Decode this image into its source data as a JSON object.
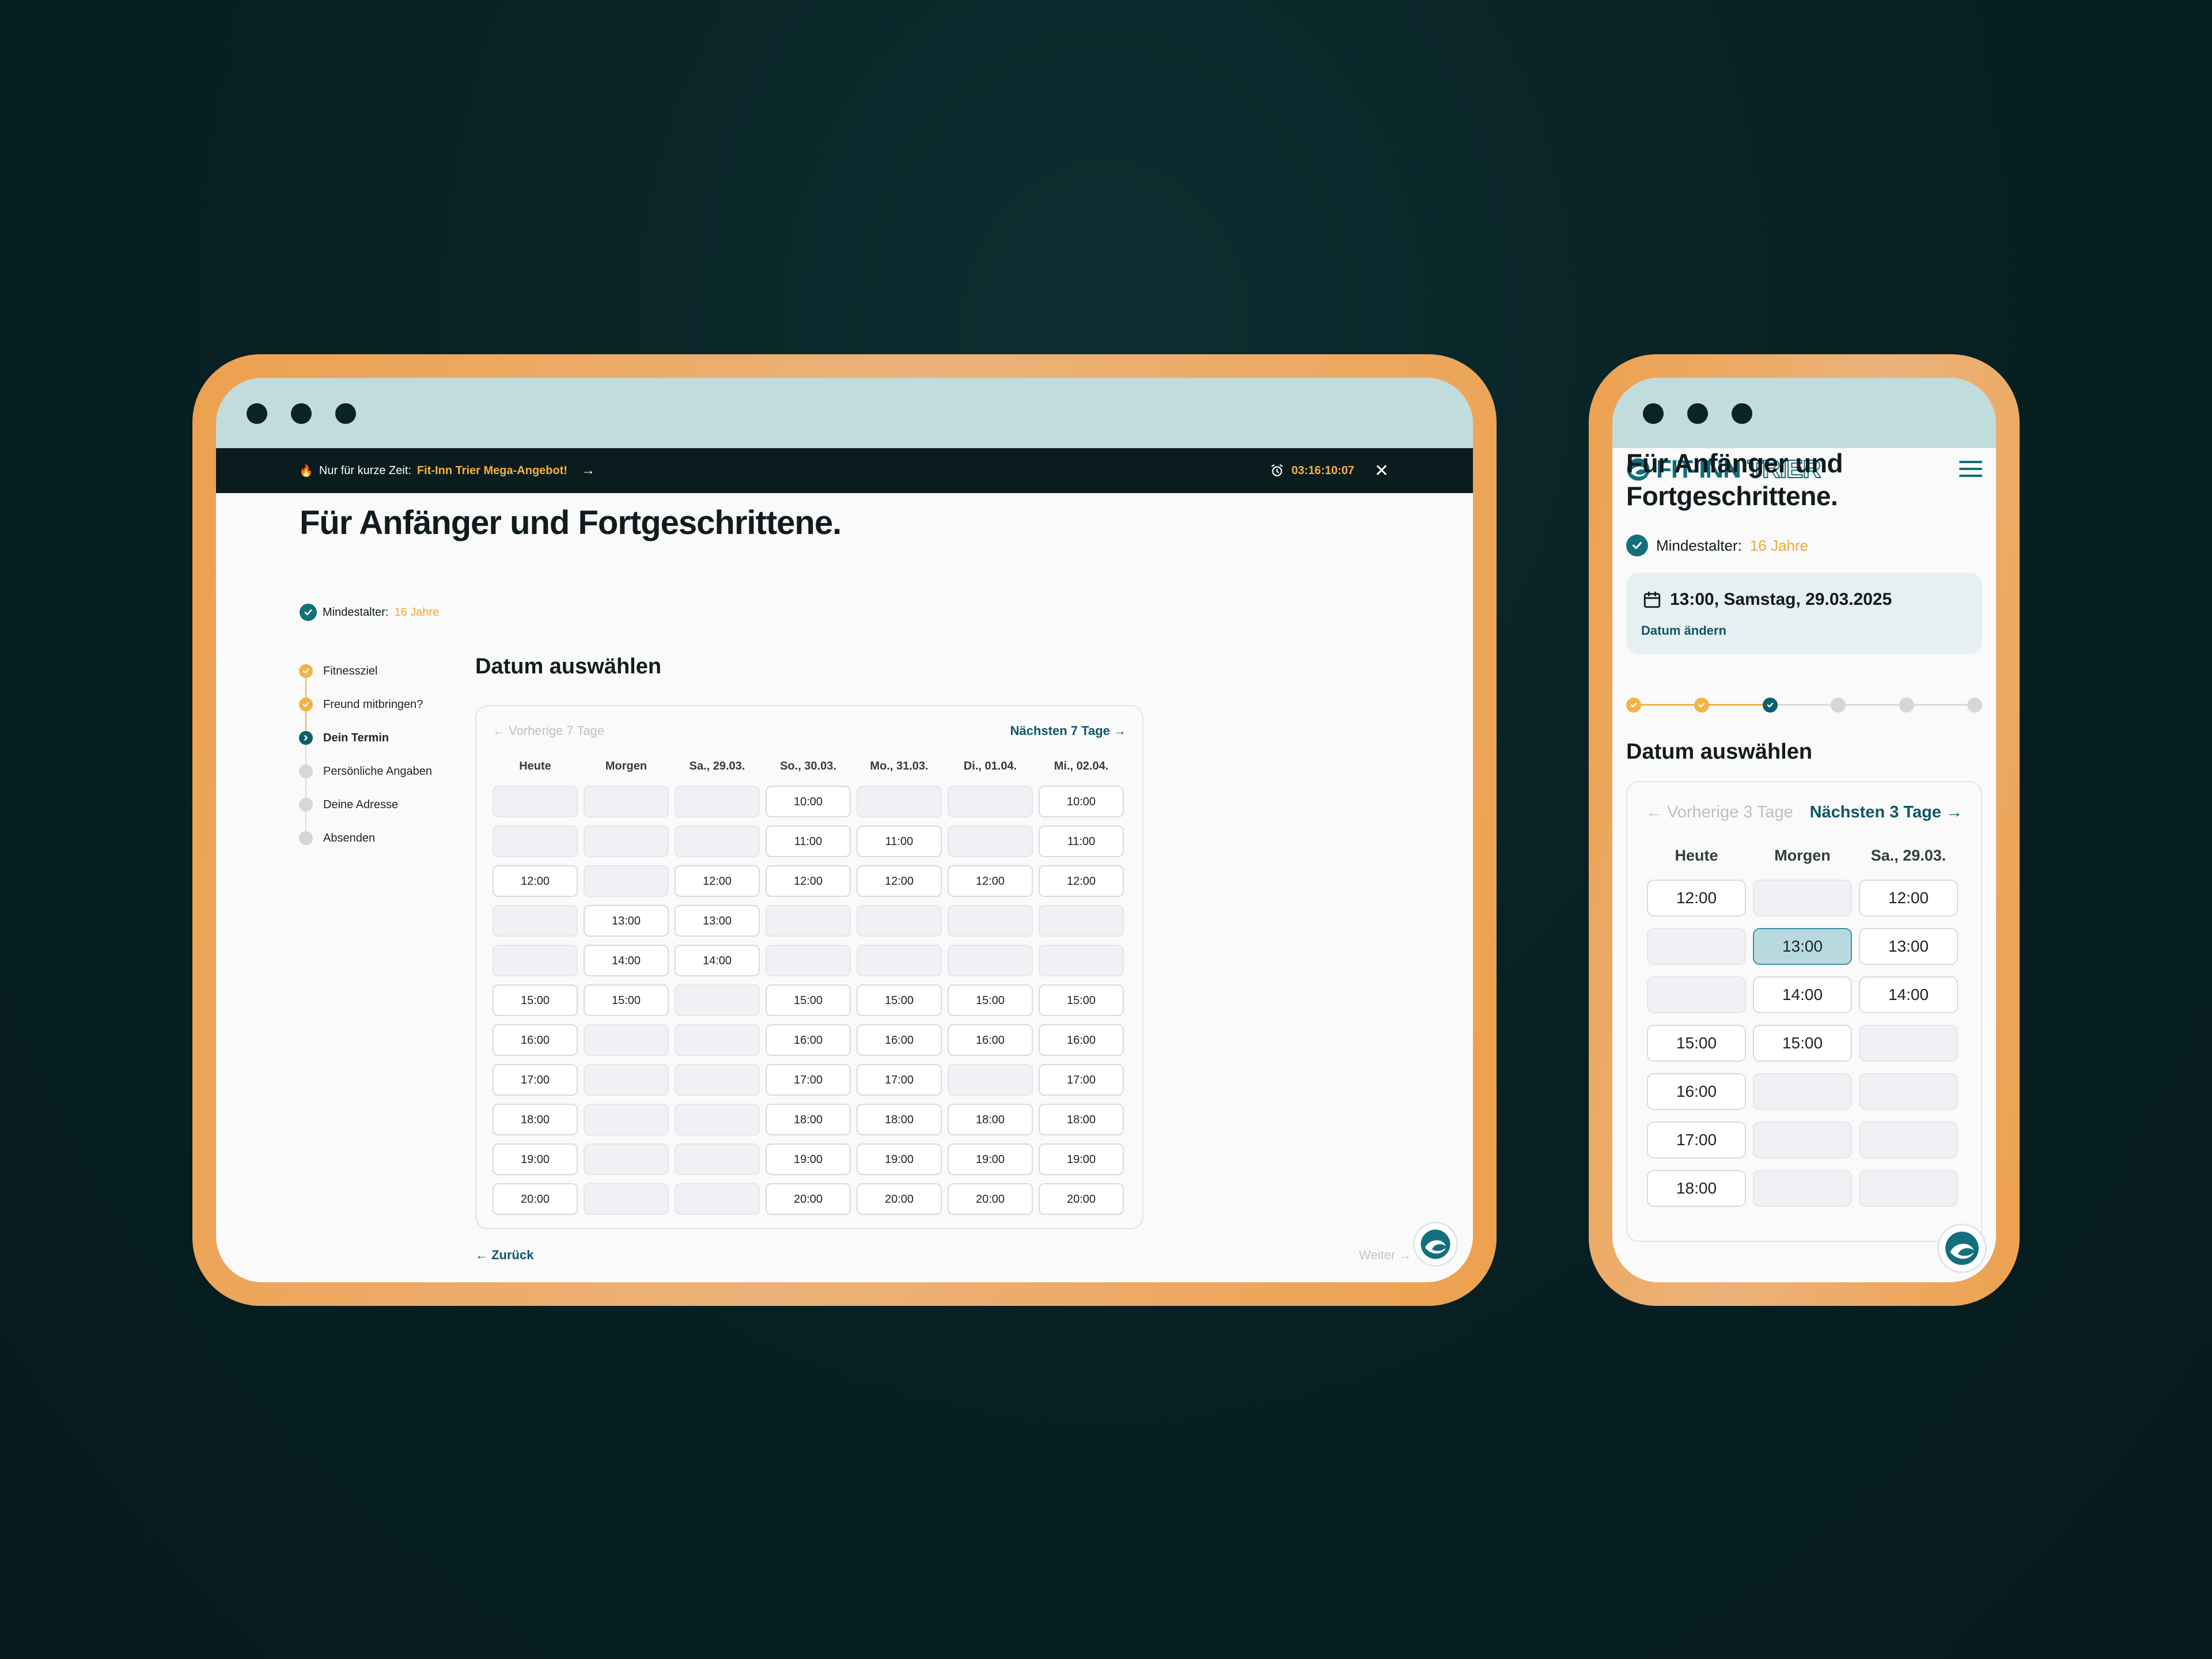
{
  "colors": {
    "background": "#082124",
    "frame_orange": "#eda14f",
    "titlebar": "#c1dcdd",
    "accent_teal": "#0f5766",
    "accent_orange": "#f0a93a",
    "selected_slot": "#b8dadf"
  },
  "desktop": {
    "promo": {
      "prefix": "Nur für kurze Zeit:",
      "highlight": "Fit-Inn Trier Mega-Angebot!",
      "arrow": "→",
      "timer": "03:16:10:07",
      "close": "✕"
    },
    "title": "Für Anfänger und Fortgeschrittene.",
    "age_label": "Mindestalter:",
    "age_value": "16 Jahre",
    "steps": [
      {
        "label": "Fitnessziel",
        "state": "done"
      },
      {
        "label": "Freund mitbringen?",
        "state": "done"
      },
      {
        "label": "Dein Termin",
        "state": "current"
      },
      {
        "label": "Persönliche Angaben",
        "state": "todo"
      },
      {
        "label": "Deine Adresse",
        "state": "todo"
      },
      {
        "label": "Absenden",
        "state": "todo"
      }
    ],
    "section_title": "Datum auswählen",
    "prev_label": "← Vorherige 7 Tage",
    "next_label": "Nächsten 7 Tage →",
    "days": [
      "Heute",
      "Morgen",
      "Sa., 29.03.",
      "So., 30.03.",
      "Mo., 31.03.",
      "Di., 01.04.",
      "Mi., 02.04."
    ],
    "rows": [
      [
        "",
        "",
        "",
        "10:00",
        "",
        "",
        "10:00"
      ],
      [
        "",
        "",
        "",
        "11:00",
        "11:00",
        "",
        "11:00"
      ],
      [
        "12:00",
        "",
        "12:00",
        "12:00",
        "12:00",
        "12:00",
        "12:00"
      ],
      [
        "",
        "13:00",
        "13:00",
        "",
        "",
        "",
        ""
      ],
      [
        "",
        "14:00",
        "14:00",
        "",
        "",
        "",
        ""
      ],
      [
        "15:00",
        "15:00",
        "",
        "15:00",
        "15:00",
        "15:00",
        "15:00"
      ],
      [
        "16:00",
        "",
        "",
        "16:00",
        "16:00",
        "16:00",
        "16:00"
      ],
      [
        "17:00",
        "",
        "",
        "17:00",
        "17:00",
        "",
        "17:00"
      ],
      [
        "18:00",
        "",
        "",
        "18:00",
        "18:00",
        "18:00",
        "18:00"
      ],
      [
        "19:00",
        "",
        "",
        "19:00",
        "19:00",
        "19:00",
        "19:00"
      ],
      [
        "20:00",
        "",
        "",
        "20:00",
        "20:00",
        "20:00",
        "20:00"
      ]
    ],
    "back_label": "← Zurück",
    "next_button": "Weiter →"
  },
  "mobile": {
    "logo_text": "FIT-INN",
    "logo_text2": "TRIER",
    "title": "Für Anfänger und Fortgeschrittene.",
    "age_label": "Mindestalter:",
    "age_value": "16 Jahre",
    "selected_date": "13:00, Samstag, 29.03.2025",
    "change_date": "Datum ändern",
    "progress_states": [
      "done",
      "done",
      "current",
      "todo",
      "todo",
      "todo"
    ],
    "section_title": "Datum auswählen",
    "prev_label": "← Vorherige 3 Tage",
    "next_label": "Nächsten 3 Tage →",
    "days": [
      "Heute",
      "Morgen",
      "Sa., 29.03."
    ],
    "selected_slot": "13:00",
    "rows": [
      [
        "12:00",
        "",
        "12:00"
      ],
      [
        "",
        "13:00",
        "13:00"
      ],
      [
        "",
        "14:00",
        "14:00"
      ],
      [
        "15:00",
        "15:00",
        ""
      ],
      [
        "16:00",
        "",
        ""
      ],
      [
        "17:00",
        "",
        ""
      ],
      [
        "18:00",
        "",
        ""
      ]
    ]
  }
}
